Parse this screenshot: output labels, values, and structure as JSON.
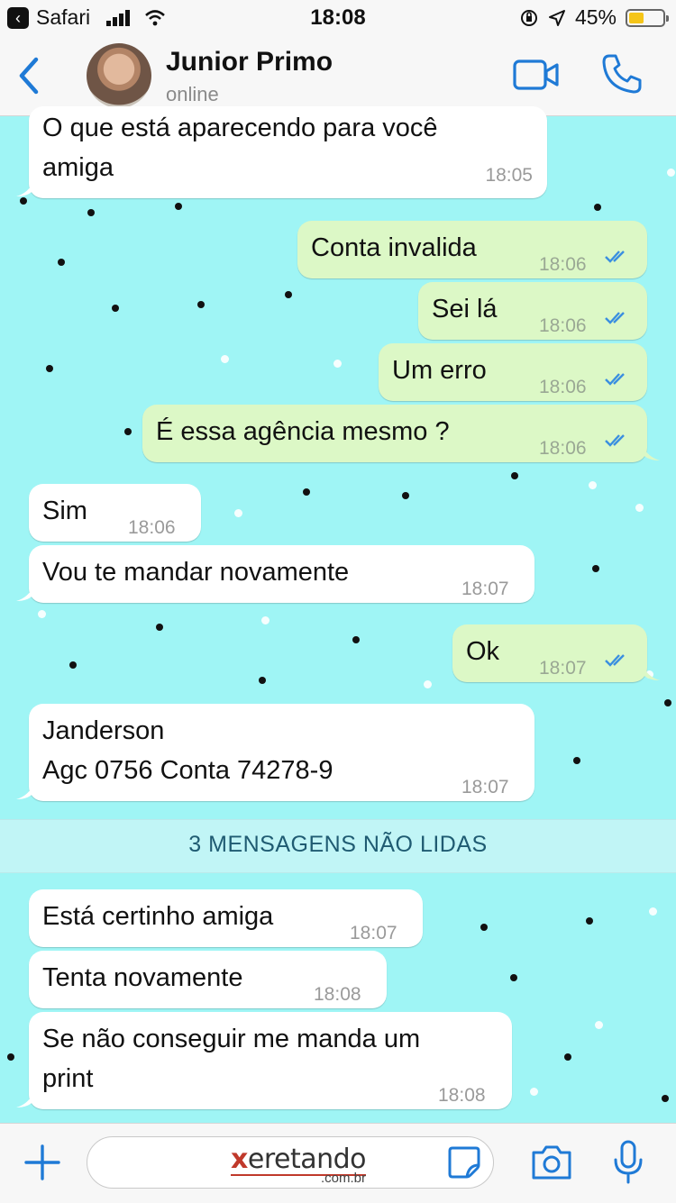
{
  "status_bar": {
    "back_app": "Safari",
    "time": "18:08",
    "battery": "45%",
    "battery_level": 0.45
  },
  "header": {
    "contact_name": "Junior Primo",
    "contact_status": "online"
  },
  "messages": [
    {
      "direction": "in",
      "text": "O que está aparecendo para você\namiga",
      "time": "18:05"
    },
    {
      "direction": "out",
      "text": "Conta invalida",
      "time": "18:06",
      "read": true
    },
    {
      "direction": "out",
      "text": "Sei lá",
      "time": "18:06",
      "read": true
    },
    {
      "direction": "out",
      "text": "Um erro",
      "time": "18:06",
      "read": true
    },
    {
      "direction": "out",
      "text": "É essa agência mesmo ?",
      "time": "18:06",
      "read": true
    },
    {
      "direction": "in",
      "text": "Sim",
      "time": "18:06"
    },
    {
      "direction": "in",
      "text": "Vou te mandar novamente",
      "time": "18:07"
    },
    {
      "direction": "out",
      "text": "Ok",
      "time": "18:07",
      "read": true
    },
    {
      "direction": "in",
      "text": "Janderson\nAgc 0756 Conta 74278-9",
      "time": "18:07"
    },
    {
      "direction": "in",
      "text": "Está certinho amiga",
      "time": "18:07"
    },
    {
      "direction": "in",
      "text": "Tenta novamente",
      "time": "18:08"
    },
    {
      "direction": "in",
      "text": "Se não conseguir me manda um\nprint",
      "time": "18:08"
    }
  ],
  "unread_divider": "3 MENSAGENS NÃO LIDAS",
  "watermark": {
    "brand_x": "x",
    "brand_rest": "eretando",
    "domain": ".com.br"
  },
  "colors": {
    "chat_background": "#9ff5f5",
    "outgoing_bubble": "#dcf8c6",
    "incoming_bubble": "#ffffff",
    "accent": "#1f7ad6",
    "read_ticks": "#3a8fe0"
  },
  "icons": [
    "back-chevron-icon",
    "video-call-icon",
    "phone-call-icon",
    "plus-icon",
    "sticker-icon",
    "camera-icon",
    "microphone-icon"
  ]
}
